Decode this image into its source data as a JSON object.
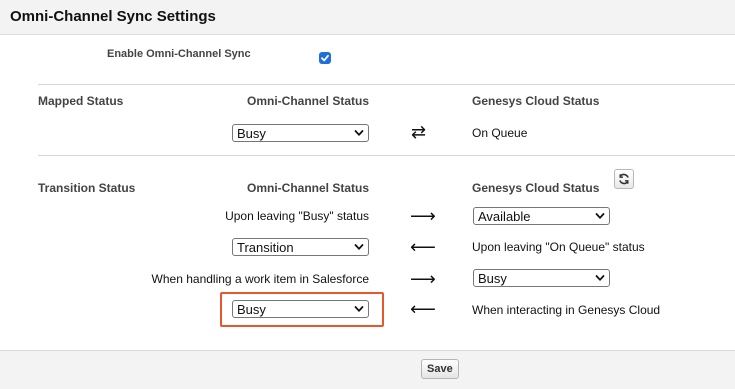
{
  "header": {
    "title": "Omni-Channel Sync Settings"
  },
  "enable": {
    "label": "Enable Omni-Channel Sync",
    "checked": true
  },
  "mapped": {
    "section_label": "Mapped Status",
    "omni_header": "Omni-Channel Status",
    "genesys_header": "Genesys Cloud Status",
    "omni_value": "Busy",
    "arrow": "⇄",
    "genesys_value": "On Queue"
  },
  "transition": {
    "section_label": "Transition Status",
    "omni_header": "Omni-Channel Status",
    "genesys_header": "Genesys Cloud Status",
    "rows": [
      {
        "left": "Upon leaving \"Busy\" status",
        "arrow": "⟶",
        "right": "Available"
      },
      {
        "left": "Transition",
        "arrow": "⟵",
        "right": "Upon leaving \"On Queue\" status"
      },
      {
        "left": "When handling a work item in Salesforce",
        "arrow": "⟶",
        "right": "Busy"
      },
      {
        "left": "Busy",
        "arrow": "⟵",
        "right": "When interacting in Genesys Cloud"
      }
    ]
  },
  "footer": {
    "save_label": "Save"
  },
  "colors": {
    "highlight": "#e8572a",
    "checkbox": "#1e6fd9"
  }
}
